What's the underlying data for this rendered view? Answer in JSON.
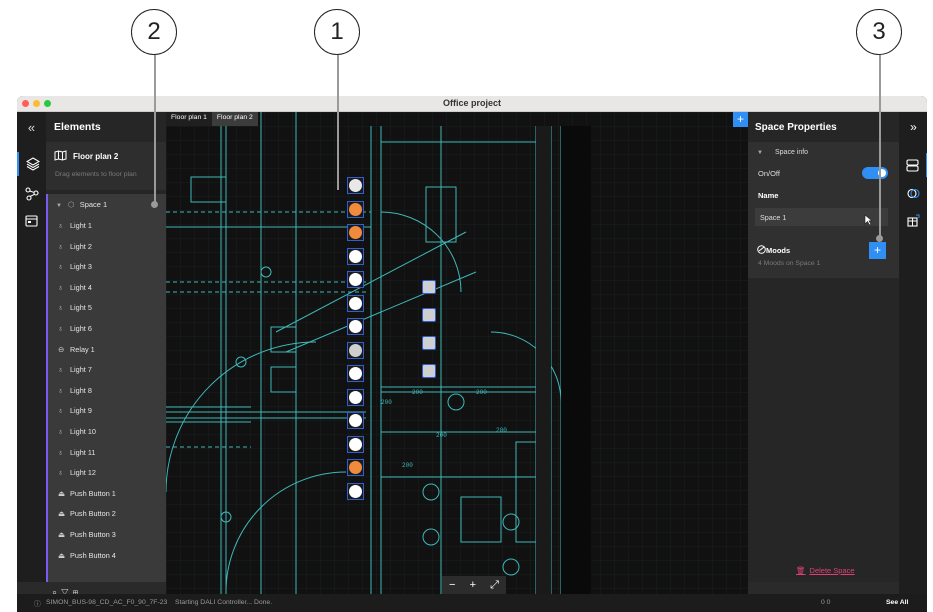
{
  "callouts": [
    "1",
    "2",
    "3"
  ],
  "window": {
    "title": "Office project",
    "traffic_colors": [
      "#ff5f57",
      "#febc2e",
      "#28c840"
    ]
  },
  "left_rail": {
    "collapse_glyph": "«",
    "icons": [
      "layers-icon",
      "connections-icon",
      "calendar-icon"
    ]
  },
  "elements_panel": {
    "title": "Elements",
    "floor_plan": {
      "name": "Floor plan 2",
      "hint": "Drag elements to floor plan"
    },
    "space": {
      "name": "Space 1"
    },
    "items": [
      {
        "label": "Light 1",
        "icon": "bulb-icon"
      },
      {
        "label": "Light 2",
        "icon": "bulb-icon"
      },
      {
        "label": "Light 3",
        "icon": "bulb-icon"
      },
      {
        "label": "Light 4",
        "icon": "bulb-icon"
      },
      {
        "label": "Light 5",
        "icon": "bulb-icon"
      },
      {
        "label": "Light 6",
        "icon": "bulb-icon"
      },
      {
        "label": "Relay 1",
        "icon": "relay-icon"
      },
      {
        "label": "Light 7",
        "icon": "bulb-icon"
      },
      {
        "label": "Light 8",
        "icon": "bulb-icon"
      },
      {
        "label": "Light 9",
        "icon": "bulb-icon"
      },
      {
        "label": "Light 10",
        "icon": "bulb-icon"
      },
      {
        "label": "Light 11",
        "icon": "bulb-icon"
      },
      {
        "label": "Light 12",
        "icon": "bulb-icon"
      },
      {
        "label": "Push Button 1",
        "icon": "push-button-icon"
      },
      {
        "label": "Push Button 2",
        "icon": "push-button-icon"
      },
      {
        "label": "Push Button 3",
        "icon": "push-button-icon"
      },
      {
        "label": "Push Button 4",
        "icon": "push-button-icon"
      }
    ]
  },
  "canvas": {
    "tabs": [
      {
        "label": "Floor plan 1",
        "active": false
      },
      {
        "label": "Floor plan 2",
        "active": true
      }
    ],
    "add_glyph": "+",
    "zoom_controls": [
      "−",
      "+",
      "⤢"
    ],
    "lights": [
      {
        "state": "on-white"
      },
      {
        "state": "orange"
      },
      {
        "state": "orange"
      },
      {
        "state": "white"
      },
      {
        "state": "white"
      },
      {
        "state": "white"
      },
      {
        "state": "white"
      },
      {
        "state": "relay"
      },
      {
        "state": "white"
      },
      {
        "state": "white"
      },
      {
        "state": "white"
      },
      {
        "state": "white"
      },
      {
        "state": "orange"
      },
      {
        "state": "white"
      }
    ],
    "push_buttons": 4
  },
  "properties_panel": {
    "title": "Space Properties",
    "expand_glyph": "»",
    "section_label": "Space info",
    "onoff_label": "On/Off",
    "onoff_value": true,
    "name_label": "Name",
    "name_value": "Space 1",
    "moods_label": "Moods",
    "moods_sub": "4 Moods on Space 1",
    "add_glyph": "+",
    "delete_label": "Delete Space"
  },
  "status_bar": {
    "device": "SIMON_BUS-98_CD_AC_F0_90_7F-23",
    "message": "Starting DALI Controller... Done.",
    "counts": "0   0",
    "see_all": "See All"
  },
  "colors": {
    "accent": "#2f8ff5",
    "orange": "#f08a3c",
    "blueprint": "#3fb8b8",
    "danger": "#e0407a",
    "purple": "#7b5cf0"
  }
}
